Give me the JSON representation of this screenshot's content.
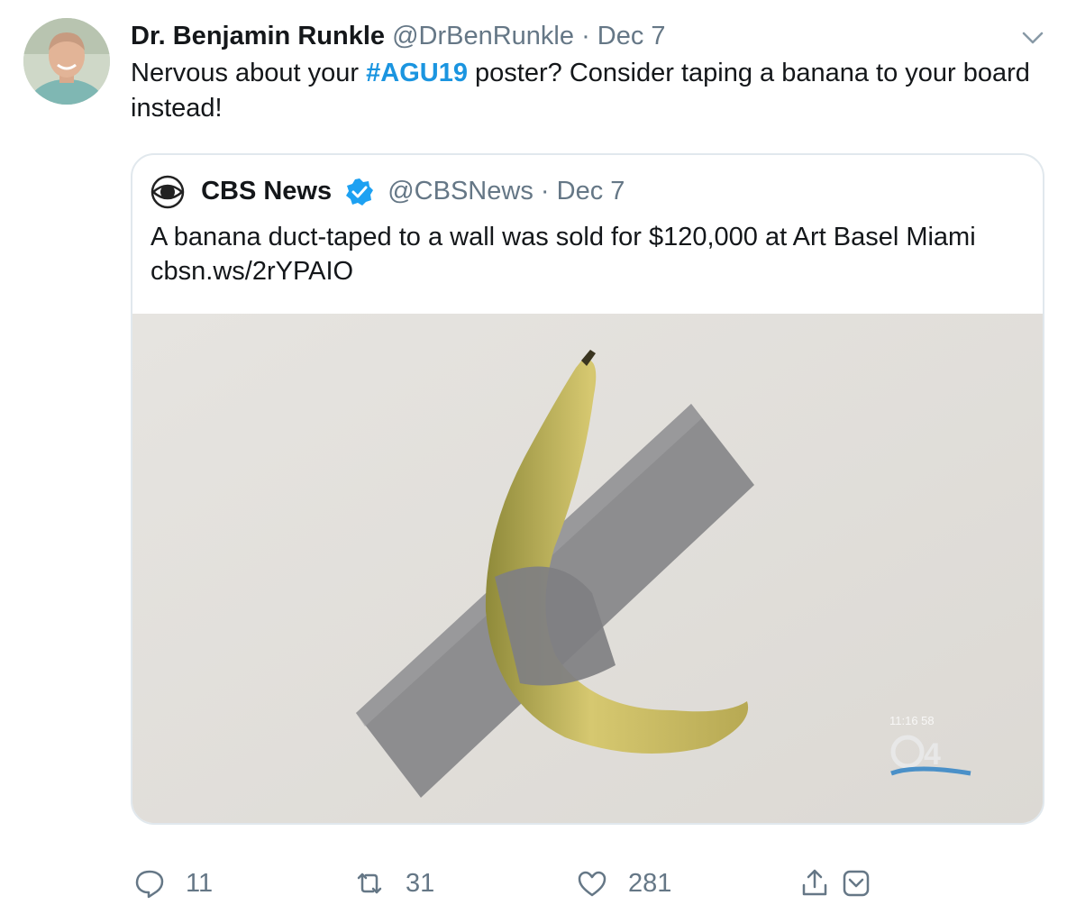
{
  "tweet": {
    "author_name": "Dr. Benjamin Runkle",
    "author_handle": "@DrBenRunkle",
    "separator": "·",
    "date": "Dec 7",
    "text_before": "Nervous about your ",
    "hashtag": "#AGU19",
    "text_after": " poster? Consider taping a banana to your board instead!"
  },
  "quote": {
    "name": "CBS News",
    "handle": "@CBSNews",
    "separator": "·",
    "date": "Dec 7",
    "text": "A banana duct-taped to a wall was sold for $120,000 at Art Basel Miami cbsn.ws/2rYPAIO",
    "media_watermark": "11:16 58"
  },
  "actions": {
    "replies": "11",
    "retweets": "31",
    "likes": "281"
  },
  "icons": {
    "caret": "chevron-down-icon",
    "reply": "reply-icon",
    "retweet": "retweet-icon",
    "like": "heart-icon",
    "share": "share-icon",
    "dm": "message-icon"
  },
  "colors": {
    "link": "#1b95e0",
    "muted": "#657786",
    "border": "#e1e8ed"
  }
}
